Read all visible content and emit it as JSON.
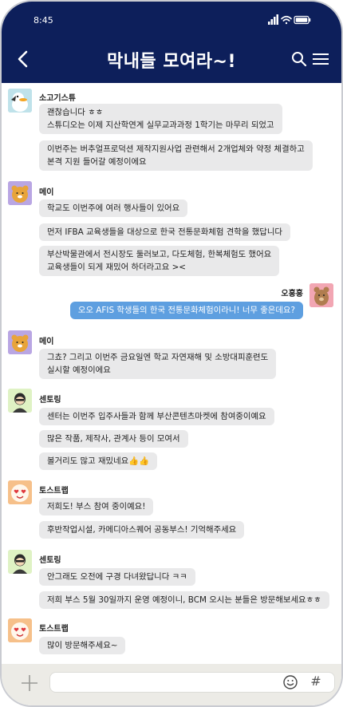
{
  "status": {
    "time": "8:45"
  },
  "header": {
    "title": "막내들 모여라~!"
  },
  "messages": [
    {
      "sender": "소고기스튜",
      "avatar": "duck",
      "bubbles": [
        "괜찮습니다 ㅎㅎ\n스튜디오는 이제 지산학연계 실무교과과정 1학기는 마무리 되었고",
        "이번주는 버추얼프로덕션 제작지원사업 관련해서 2개업체와 약정 체결하고\n본격 지원 들어갈 예정이에요"
      ]
    },
    {
      "sender": "메이",
      "avatar": "ryan-purple",
      "bubbles": [
        "학교도 이번주에 여러 행사들이 있어요",
        "먼저 IFBA 교육생들을 대상으로 한국 전통문화체험 견학을 했답니다",
        "부산박물관에서 전시장도 둘러보고, 다도체험, 한복체험도 했어요\n교육생들이 되게 재밌어 하더라고요 ><"
      ]
    },
    {
      "sender": "오홍홍",
      "avatar": "bear-pink",
      "mine": true,
      "bubbles": [
        "오오 AFIS 학생들의 한국 전통문화체험이라니! 너무 좋은데요?"
      ]
    },
    {
      "sender": "메이",
      "avatar": "ryan-purple",
      "bubbles": [
        "그쵸? 그리고 이번주 금요일엔 학교 자연재해 및 소방대피훈련도\n실시할 예정이에요"
      ]
    },
    {
      "sender": "센토링",
      "avatar": "person-green",
      "bubbles": [
        "센터는 이번주 입주사들과 함께 부산콘텐츠마켓에 참여중이예요",
        "많은 작품, 제작사, 관계사 등이 모여서",
        "볼거리도 많고 재밌네요👍👍"
      ]
    },
    {
      "sender": "토스트랩",
      "avatar": "heart-eyes",
      "bubbles": [
        "저희도! 부스 참여 중이예요!",
        "후반작업시설, 카메디아스퀘어 공동부스! 기억해주세요"
      ]
    },
    {
      "sender": "센토링",
      "avatar": "person-green",
      "bubbles": [
        "안그래도 오전에 구경 다녀왔답니다 ㅋㅋ",
        "저희 부스 5월 30일까지 운영 예정이니, BCM 오시는 분들은 방문해보세요ㅎㅎ"
      ]
    },
    {
      "sender": "토스트랩",
      "avatar": "heart-eyes",
      "bubbles": [
        "많이 방문해주세요~"
      ]
    }
  ],
  "input": {
    "emoji_icon": "smile-icon",
    "hash_label": "#"
  },
  "colors": {
    "header": "#0d1f5b",
    "bubble": "#e9e9ea",
    "my_bubble": "#5e9fe0"
  }
}
